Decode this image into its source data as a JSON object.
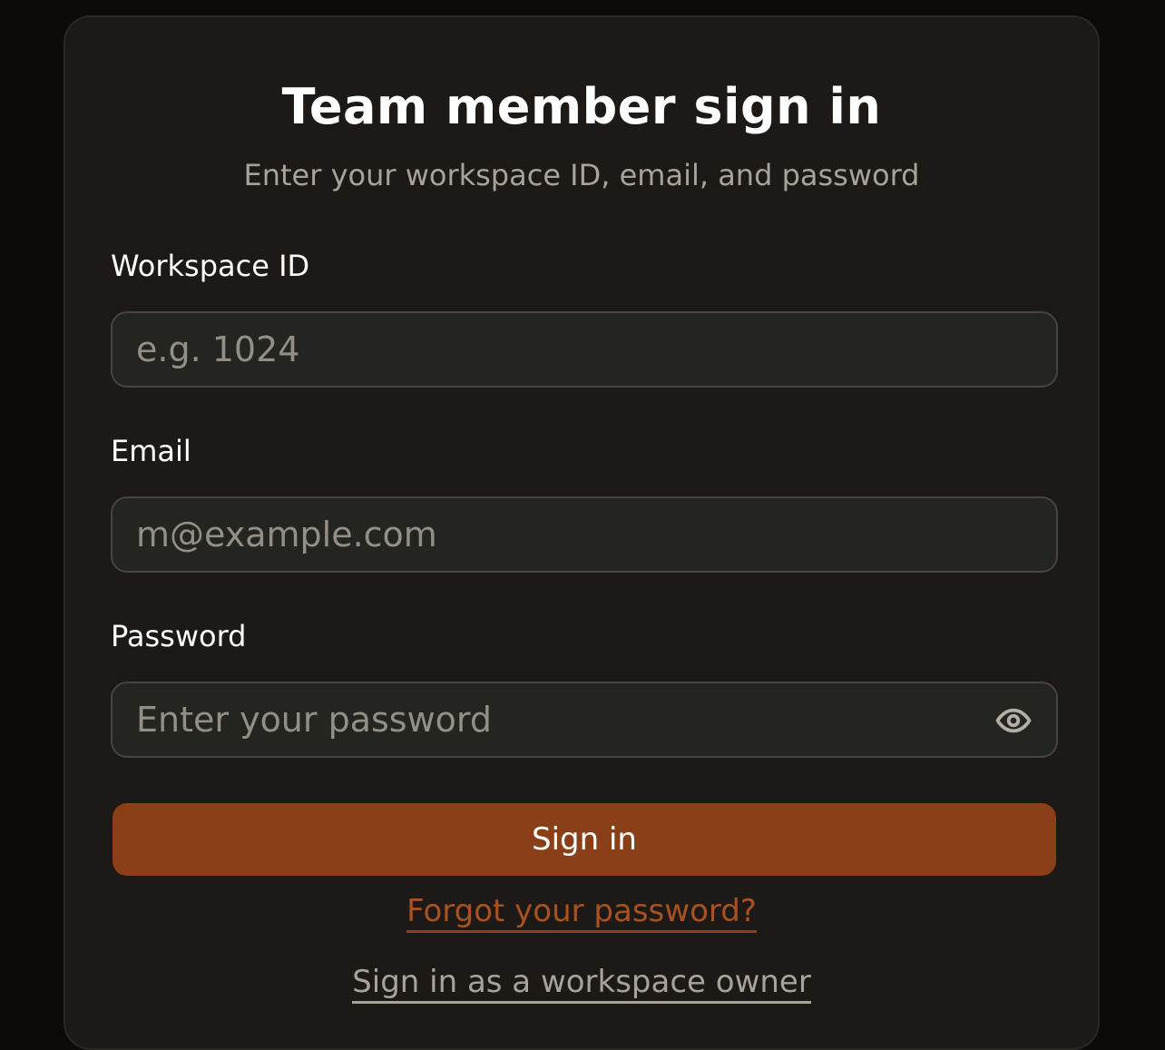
{
  "header": {
    "title": "Team member sign in",
    "subtitle": "Enter your workspace ID, email, and password"
  },
  "form": {
    "workspace": {
      "label": "Workspace ID",
      "placeholder": "e.g. 1024",
      "value": ""
    },
    "email": {
      "label": "Email",
      "placeholder": "m@example.com",
      "value": ""
    },
    "password": {
      "label": "Password",
      "placeholder": "Enter your password",
      "value": "",
      "toggle_icon": "eye-icon"
    },
    "submit_label": "Sign in"
  },
  "links": {
    "forgot_password": "Forgot your password?",
    "owner_sign_in": "Sign in as a workspace owner"
  },
  "colors": {
    "page_background": "#0c0b08",
    "card_background": "#1d1916",
    "input_background": "#242421",
    "accent": "#8b3f18",
    "link_accent": "#a7521f",
    "muted_text": "#a7a29a"
  }
}
